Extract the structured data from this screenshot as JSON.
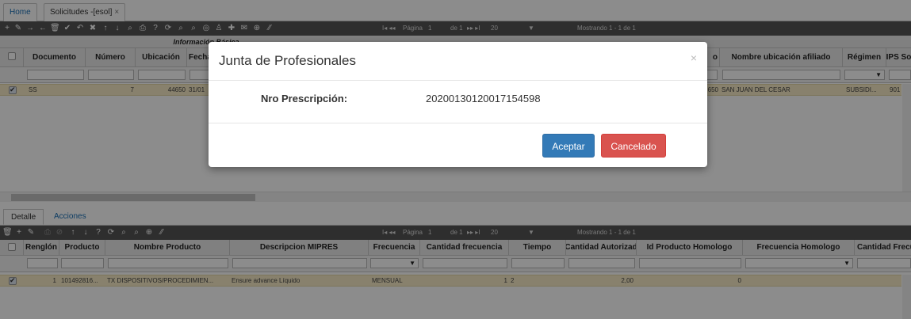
{
  "tabs": {
    "home": "Home",
    "solicitudes": "Solicitudes -[esol]",
    "close": "×"
  },
  "top_grid": {
    "pager": {
      "page_label": "Página",
      "page": "1",
      "of": "de 1",
      "page_size": "20",
      "summary": "Mostrando 1 - 1 de 1"
    },
    "group_header": "Información Básica",
    "columns": [
      "Documento",
      "Número",
      "Ubicación",
      "Fecha",
      "o",
      "Nombre ubicación afiliado",
      "Régimen",
      "IPS So"
    ],
    "row": {
      "documento": "SS",
      "numero": "7",
      "ubicacion": "44650",
      "fecha": "31/01",
      "ubic_code": "650",
      "nombre_ubicacion": "SAN JUAN DEL CESAR",
      "regimen": "SUBSIDI...",
      "ips": "901"
    },
    "regimen_select": "▼"
  },
  "detail_tabs": {
    "detalle": "Detalle",
    "acciones": "Acciones"
  },
  "bottom_grid": {
    "pager": {
      "page_label": "Página",
      "page": "1",
      "of": "de 1",
      "page_size": "20",
      "summary": "Mostrando 1 - 1 de 1"
    },
    "columns": [
      "Renglón",
      "Producto",
      "Nombre Producto",
      "Descripcion MIPRES",
      "Frecuencia",
      "Cantidad frecuencia",
      "Tiempo",
      "Cantidad Autorizad",
      "Id Producto Homologo",
      "Frecuencia Homologo",
      "Cantidad Frecu"
    ],
    "row": {
      "renglon": "1",
      "producto": "101492816...",
      "nombre_producto": "TX DISPOSITIVOS/PROCEDIMIEN...",
      "descripcion": "Ensure advance Líquido",
      "frecuencia": "MENSUAL",
      "cantidad_frecuencia": "1",
      "tiempo": "2",
      "cantidad_autorizada": "2,00",
      "id_homologo": "0"
    },
    "select_glyph": "▼"
  },
  "modal": {
    "title": "Junta de Profesionales",
    "close": "×",
    "field_label": "Nro Prescripción:",
    "field_value": "20200130120017154598",
    "accept": "Aceptar",
    "cancel": "Cancelado"
  },
  "colors": {
    "accent_blue": "#337ab7",
    "danger_red": "#d9534f",
    "row_highlight": "#f7ecc6",
    "toolbar": "#555555"
  }
}
